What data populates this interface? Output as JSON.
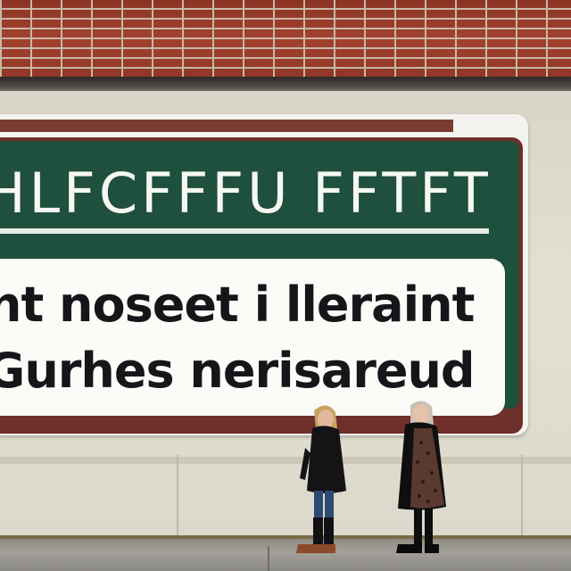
{
  "billboard": {
    "headline": "HLFCFFFU FFTFT",
    "line1": "nt noseet i lleraint",
    "line2": "Gurhes nerisareud"
  },
  "colors": {
    "brick": "#9a3d2c",
    "sign_green": "#1f4f3d",
    "sign_maroon": "#6f2f2a",
    "sign_white": "#fbfbf8",
    "wall": "#dcd8cb"
  }
}
